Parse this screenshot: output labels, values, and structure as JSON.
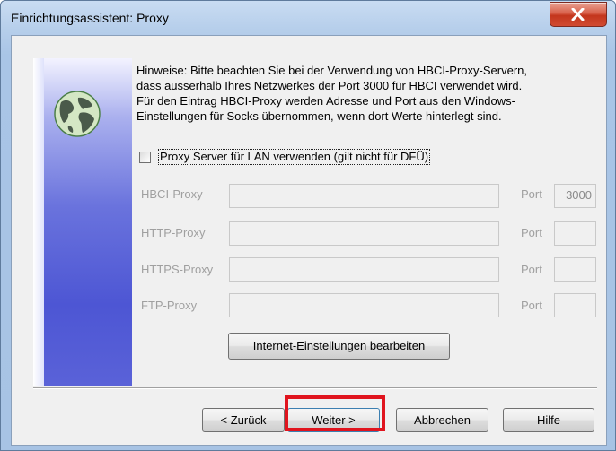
{
  "window": {
    "title": "Einrichtungsassistent: Proxy"
  },
  "hint": {
    "text": "Hinweise: Bitte beachten Sie bei der Verwendung von HBCI-Proxy-Servern,\ndass ausserhalb Ihres Netzwerkes der Port 3000 für HBCI verwendet wird.\nFür den Eintrag HBCI-Proxy werden Adresse und Port aus den Windows-\nEinstellungen für Socks übernommen, wenn dort Werte hinterlegt sind."
  },
  "proxy_checkbox": {
    "label": "Proxy Server für LAN verwenden (gilt nicht für DFÜ)",
    "checked": false
  },
  "proxies": [
    {
      "label": "HBCI-Proxy",
      "address": "",
      "port_label": "Port",
      "port": "3000"
    },
    {
      "label": "HTTP-Proxy",
      "address": "",
      "port_label": "Port",
      "port": ""
    },
    {
      "label": "HTTPS-Proxy",
      "address": "",
      "port_label": "Port",
      "port": ""
    },
    {
      "label": "FTP-Proxy",
      "address": "",
      "port_label": "Port",
      "port": ""
    }
  ],
  "buttons": {
    "internet_settings": "Internet-Einstellungen bearbeiten",
    "back": "< Zurück",
    "next": "Weiter >",
    "cancel": "Abbrechen",
    "help": "Hilfe"
  },
  "icons": {
    "close": "close-icon",
    "globe": "globe-icon"
  },
  "colors": {
    "highlight": "#e0141e",
    "close_button": "#c3361d",
    "side_panel": "#4d56d4"
  }
}
